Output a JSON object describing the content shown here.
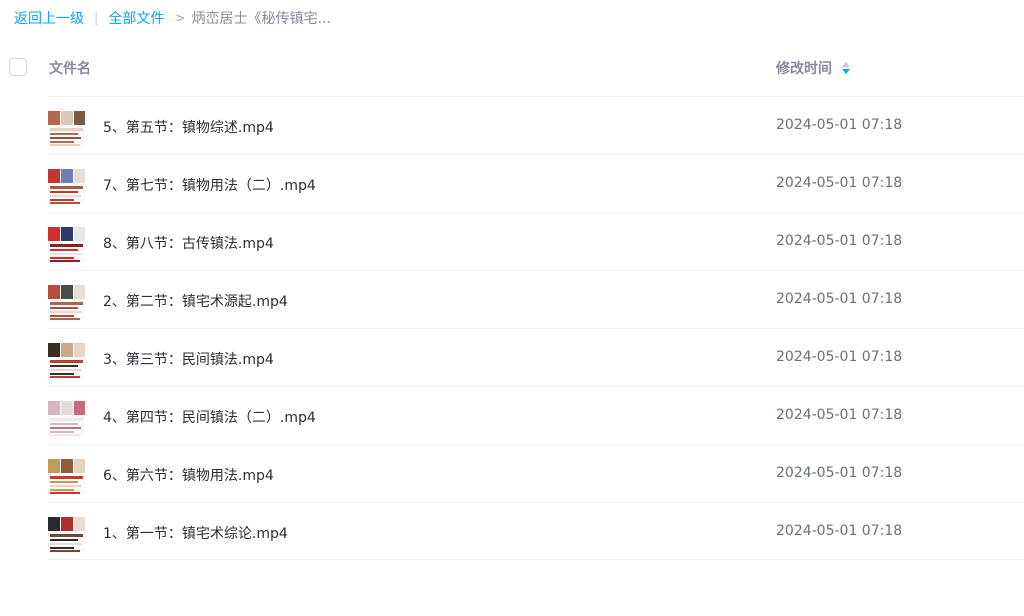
{
  "breadcrumb": {
    "back_label": "返回上一级",
    "divider": "|",
    "all_files_label": "全部文件",
    "arrow": ">",
    "current_label": "炳峦居士《秘传镇宅..."
  },
  "header": {
    "name_column": "文件名",
    "time_column": "修改时间"
  },
  "files": [
    {
      "name": "5、第五节：镇物综述.mp4",
      "modified": "2024-05-01 07:18",
      "icon": "video-thumbnail-icon"
    },
    {
      "name": "7、第七节：镇物用法（二）.mp4",
      "modified": "2024-05-01 07:18",
      "icon": "video-thumbnail-icon"
    },
    {
      "name": "8、第八节：古传镇法.mp4",
      "modified": "2024-05-01 07:18",
      "icon": "video-thumbnail-icon"
    },
    {
      "name": "2、第二节：镇宅术源起.mp4",
      "modified": "2024-05-01 07:18",
      "icon": "video-thumbnail-icon"
    },
    {
      "name": "3、第三节：民间镇法.mp4",
      "modified": "2024-05-01 07:18",
      "icon": "video-thumbnail-icon"
    },
    {
      "name": "4、第四节：民间镇法（二）.mp4",
      "modified": "2024-05-01 07:18",
      "icon": "video-thumbnail-icon"
    },
    {
      "name": "6、第六节：镇物用法.mp4",
      "modified": "2024-05-01 07:18",
      "icon": "video-thumbnail-icon"
    },
    {
      "name": "1、第一节：镇宅术综论.mp4",
      "modified": "2024-05-01 07:18",
      "icon": "video-thumbnail-icon"
    }
  ],
  "colors": {
    "link": "#06a7ff",
    "muted": "#878c9c",
    "text": "#2b2f36",
    "row_border": "#f0f1f3"
  }
}
